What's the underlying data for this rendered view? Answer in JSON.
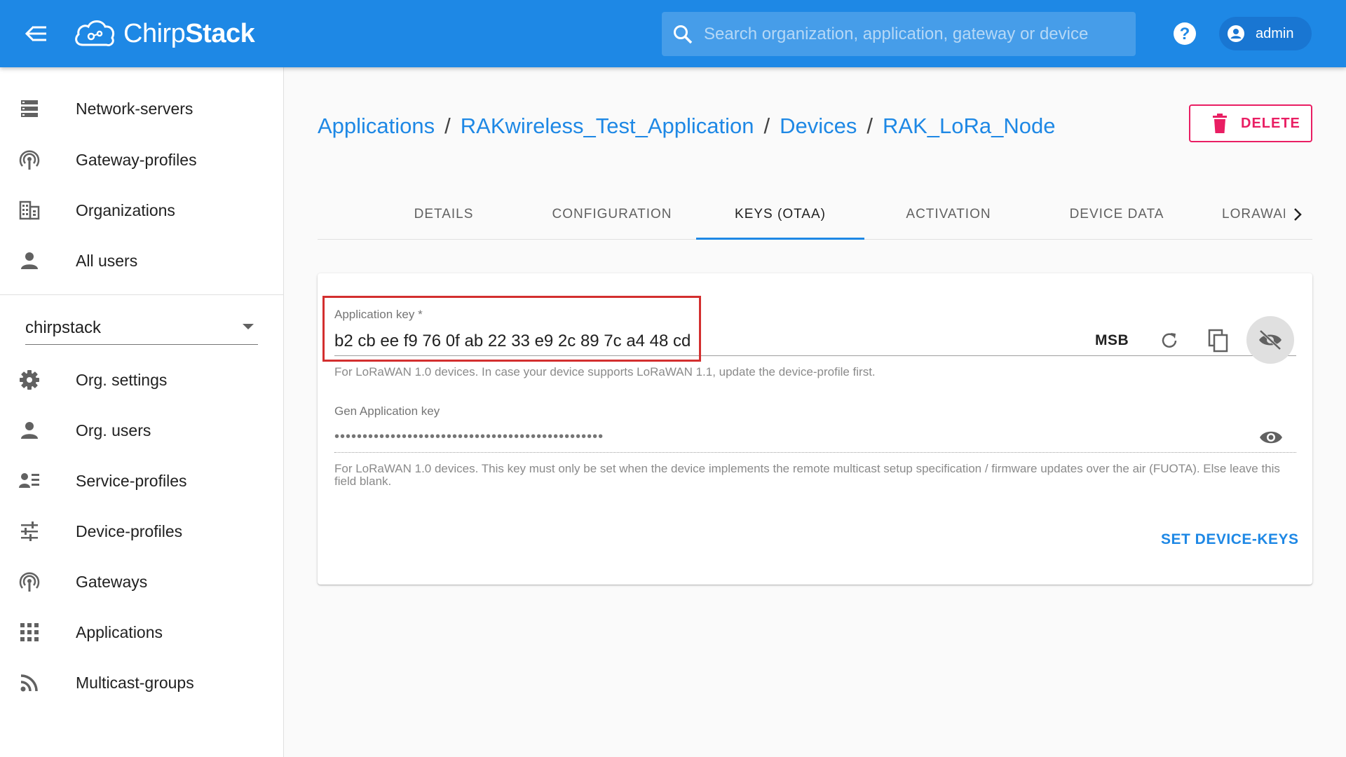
{
  "app": {
    "name_light": "Chirp",
    "name_bold": "Stack"
  },
  "search": {
    "placeholder": "Search organization, application, gateway or device"
  },
  "user": {
    "name": "admin"
  },
  "sidebar": {
    "admin_items": [
      {
        "label": "Network-servers",
        "icon": "server-icon"
      },
      {
        "label": "Gateway-profiles",
        "icon": "antenna-icon"
      },
      {
        "label": "Organizations",
        "icon": "building-icon"
      },
      {
        "label": "All users",
        "icon": "person-icon"
      }
    ],
    "org_selector": {
      "value": "chirpstack"
    },
    "org_items": [
      {
        "label": "Org. settings",
        "icon": "gear-icon"
      },
      {
        "label": "Org. users",
        "icon": "person-icon"
      },
      {
        "label": "Service-profiles",
        "icon": "service-list-icon"
      },
      {
        "label": "Device-profiles",
        "icon": "sliders-icon"
      },
      {
        "label": "Gateways",
        "icon": "antenna-icon"
      },
      {
        "label": "Applications",
        "icon": "apps-grid-icon"
      },
      {
        "label": "Multicast-groups",
        "icon": "rss-icon"
      }
    ]
  },
  "breadcrumb": {
    "items": [
      "Applications",
      "RAKwireless_Test_Application",
      "Devices",
      "RAK_LoRa_Node"
    ],
    "separator": "/"
  },
  "actions": {
    "delete_label": "DELETE"
  },
  "tabs": {
    "items": [
      "DETAILS",
      "CONFIGURATION",
      "KEYS (OTAA)",
      "ACTIVATION",
      "DEVICE DATA"
    ],
    "partial": "LORAWAN FRAMES",
    "active": "KEYS (OTAA)"
  },
  "form": {
    "app_key": {
      "label": "Application key *",
      "value": "b2 cb ee f9 76 0f ab 22 33 e9 2c 89 7c a4 48 cd",
      "byte_order": "MSB",
      "helper": "For LoRaWAN 1.0 devices. In case your device supports LoRaWAN 1.1, update the device-profile first."
    },
    "gen_app_key": {
      "label": "Gen Application key",
      "value_masked": "••••••••••••••••••••••••••••••••••••••••••••••••",
      "helper": "For LoRaWAN 1.0 devices. This key must only be set when the device implements the remote multicast setup specification / firmware updates over the air (FUOTA). Else leave this field blank."
    },
    "submit_label": "SET DEVICE-KEYS"
  },
  "colors": {
    "primary": "#1e88e5",
    "danger": "#e91e63",
    "highlight_box": "#d32f2f"
  }
}
